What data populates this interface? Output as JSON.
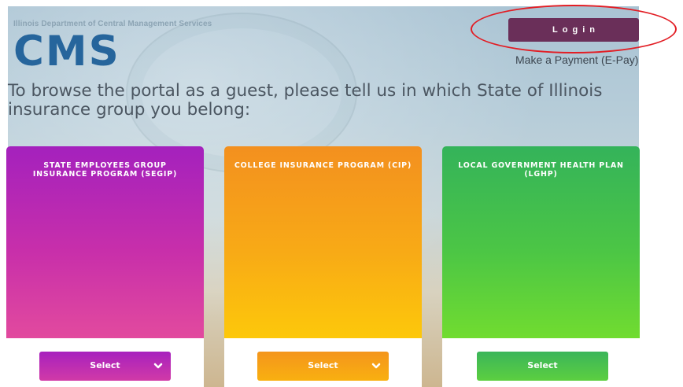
{
  "header": {
    "agency_name": "Illinois Department of Central Management Services",
    "logo_text": "CMS",
    "login_label": "Login",
    "pay_link_label": "Make a Payment (E-Pay)"
  },
  "prompt": "To browse the portal as a guest, please tell us in which State of Illinois insurance group you belong:",
  "groups": [
    {
      "title": "STATE EMPLOYEES GROUP INSURANCE PROGRAM (SEGIP)",
      "select_label": "Select",
      "color": "#b52bb5"
    },
    {
      "title": "COLLEGE INSURANCE PROGRAM (CIP)",
      "select_label": "Select",
      "color": "#f7a01a"
    },
    {
      "title": "LOCAL GOVERNMENT HEALTH PLAN (LGHP)",
      "select_label": "Select",
      "color": "#45bf4e"
    }
  ],
  "colors": {
    "login_button": "#6a2f59",
    "logo": "#26659c",
    "annotation_ring": "#e21d24"
  },
  "icons": {
    "select_dropdown": "chevron-down-icon"
  }
}
